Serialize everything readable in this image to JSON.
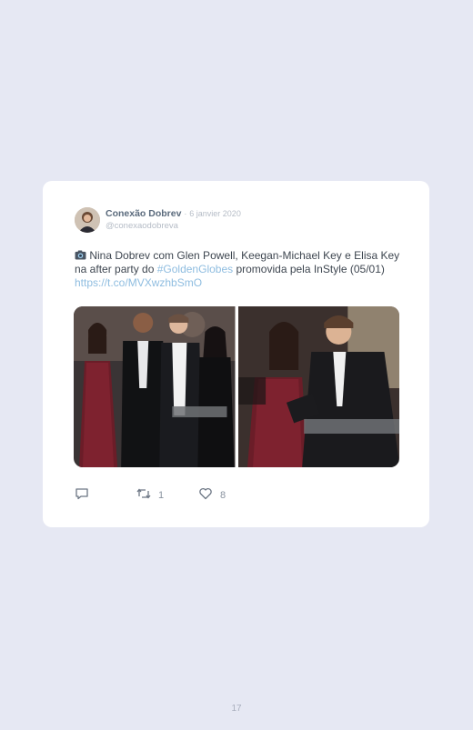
{
  "tweet": {
    "author_name": "Conexão Dobrev",
    "separator": "·",
    "date": "6 janvier 2020",
    "handle": "@conexaodobreva",
    "text_before": " Nina Dobrev com Glen Powell, Keegan-Michael Key e Elisa Key na after party do ",
    "hashtag": "#GoldenGlobes",
    "text_after": " promovida pela InStyle (05/01) ",
    "link": "https://t.co/MVXwzhbSmO",
    "camera_icon": "camera-icon",
    "retweet_count": "1",
    "like_count": "8"
  },
  "icons": {
    "reply": "reply-icon",
    "retweet": "retweet-icon",
    "like": "heart-icon"
  },
  "page": {
    "number": "17"
  }
}
